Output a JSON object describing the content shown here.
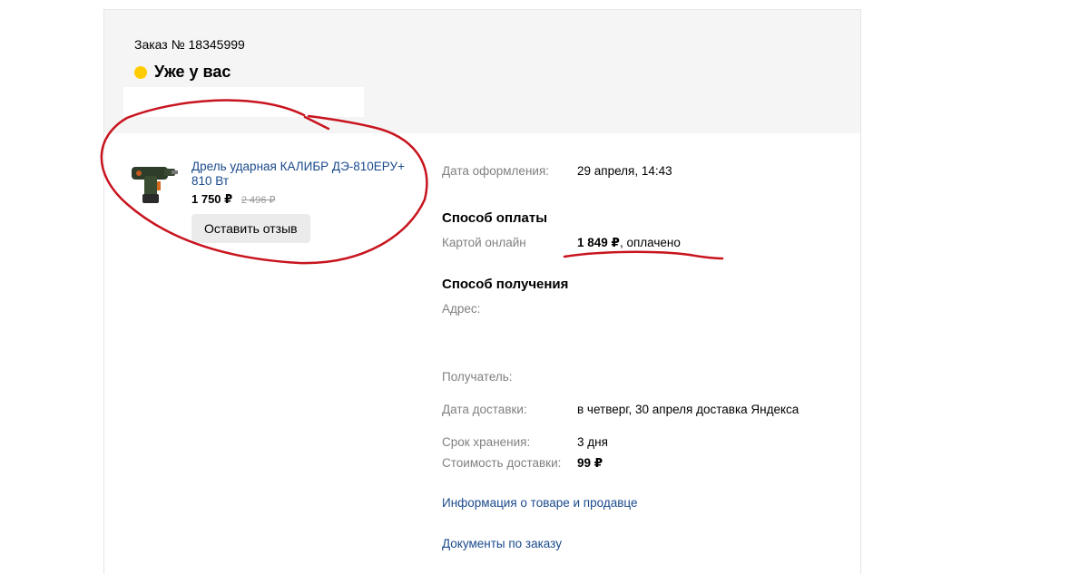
{
  "order": {
    "number_label": "Заказ № 18345999",
    "status": "Уже у вас",
    "status_color": "#ffcc00"
  },
  "product": {
    "image_icon": "drill-image",
    "title": "Дрель ударная КАЛИБР ДЭ-810ЕРУ+ 810 Вт",
    "price": "1 750 ₽",
    "old_price": "2 496 ₽",
    "review_button": "Оставить отзыв"
  },
  "details": {
    "order_date_label": "Дата оформления:",
    "order_date_value": "29 апреля, 14:43",
    "payment_title": "Способ оплаты",
    "payment_method": "Картой онлайн",
    "payment_amount": "1 849 ₽",
    "payment_status": ", оплачено",
    "delivery_title": "Способ получения",
    "address_label": "Адрес:",
    "recipient_label": "Получатель:",
    "delivery_date_label": "Дата доставки:",
    "delivery_date_value": "в четверг, 30 апреля доставка Яндекса",
    "storage_label": "Срок хранения:",
    "storage_value": "3 дня",
    "delivery_cost_label": "Стоимость доставки:",
    "delivery_cost_value": "99 ₽",
    "seller_info_link": "Информация о товаре и продавце",
    "documents_link": "Документы по заказу"
  },
  "annotation_color": "#c8141e"
}
